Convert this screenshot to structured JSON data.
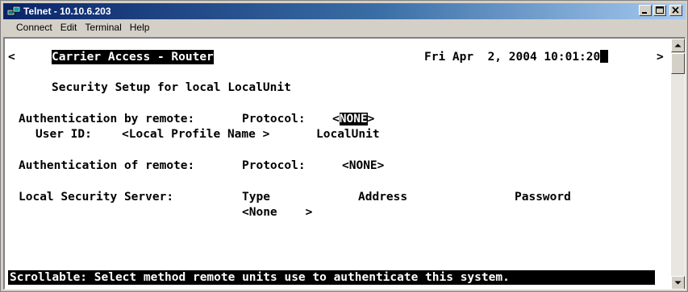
{
  "window": {
    "title": "Telnet - 10.10.6.203",
    "icon": "telnet-computer-icon"
  },
  "menu": {
    "items": [
      "Connect",
      "Edit",
      "Terminal",
      "Help"
    ]
  },
  "terminal": {
    "scroll_left_glyph": "<",
    "scroll_right_glyph": ">",
    "header_title": "Carrier Access - Router",
    "datetime": "Fri Apr  2, 2004 10:01:20",
    "screen_heading": "Security Setup for local LocalUnit",
    "auth_by_remote_label": "Authentication by remote:",
    "protocol_label": "Protocol:",
    "auth_by_remote_open": "<",
    "auth_by_remote_value": "NONE",
    "auth_by_remote_close": ">",
    "user_id_label": "User ID:",
    "user_id_field": "<Local Profile Name >",
    "user_id_value": "LocalUnit",
    "auth_of_remote_label": "Authentication of remote:",
    "auth_of_remote_protocol_label": "Protocol:",
    "auth_of_remote_value": "<NONE>",
    "local_server_label": "Local Security Server:",
    "col_type": "Type",
    "col_address": "Address",
    "col_password": "Password",
    "type_value": "<None    >",
    "status_message": "Scrollable: Select method remote units use to authenticate this system."
  },
  "colors": {
    "titlebar_start": "#0a246a",
    "titlebar_end": "#a6caf0",
    "terminal_bg": "#ffffff",
    "terminal_fg": "#000000"
  }
}
